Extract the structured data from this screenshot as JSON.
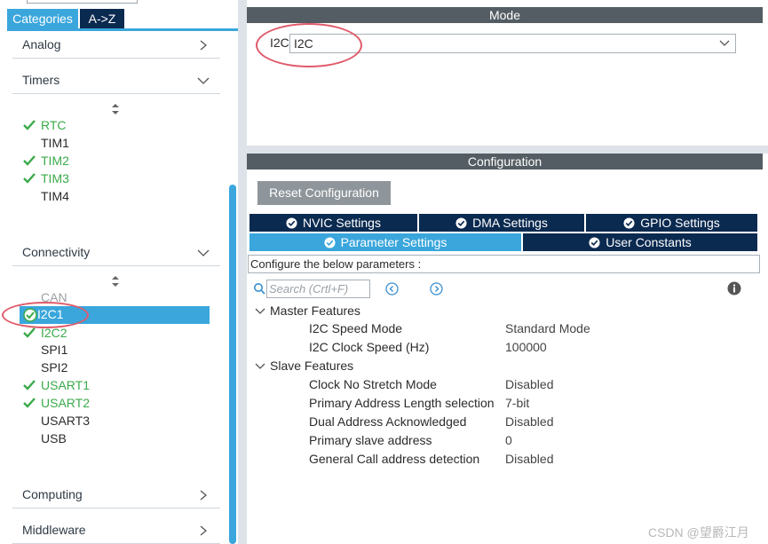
{
  "left_panel": {
    "tabs": [
      {
        "label": "Categories",
        "active": true
      },
      {
        "label": "A->Z",
        "active": false
      }
    ],
    "categories": {
      "analog": "Analog",
      "timers": "Timers",
      "connectivity": "Connectivity",
      "computing": "Computing",
      "middleware": "Middleware"
    },
    "timers": [
      {
        "name": "RTC",
        "enabled": true
      },
      {
        "name": "TIM1",
        "enabled": false
      },
      {
        "name": "TIM2",
        "enabled": true
      },
      {
        "name": "TIM3",
        "enabled": true
      },
      {
        "name": "TIM4",
        "enabled": false
      }
    ],
    "connectivity": [
      {
        "name": "CAN",
        "enabled": false
      },
      {
        "name": "I2C1",
        "enabled": true,
        "selected": true
      },
      {
        "name": "I2C2",
        "enabled": true
      },
      {
        "name": "SPI1",
        "enabled": false
      },
      {
        "name": "SPI2",
        "enabled": false
      },
      {
        "name": "USART1",
        "enabled": true
      },
      {
        "name": "USART2",
        "enabled": true
      },
      {
        "name": "USART3",
        "enabled": false
      },
      {
        "name": "USB",
        "enabled": false
      }
    ]
  },
  "mode": {
    "title": "Mode",
    "field_label": "I2C",
    "field_value": "I2C"
  },
  "configuration": {
    "title": "Configuration",
    "reset_button": "Reset Configuration",
    "tabs_row1": [
      "NVIC Settings",
      "DMA Settings",
      "GPIO Settings"
    ],
    "tabs_row2": [
      "Parameter Settings",
      "User Constants"
    ],
    "active_tab": "Parameter Settings",
    "description": "Configure the below parameters :",
    "search_placeholder": "Search (Crtl+F)",
    "groups": [
      {
        "name": "Master Features",
        "params": [
          {
            "name": "I2C Speed Mode",
            "value": "Standard Mode"
          },
          {
            "name": "I2C Clock Speed (Hz)",
            "value": "100000"
          }
        ]
      },
      {
        "name": "Slave Features",
        "params": [
          {
            "name": "Clock No Stretch Mode",
            "value": "Disabled"
          },
          {
            "name": "Primary Address Length selection",
            "value": "7-bit"
          },
          {
            "name": "Dual Address Acknowledged",
            "value": "Disabled"
          },
          {
            "name": "Primary slave address",
            "value": "0"
          },
          {
            "name": "General Call address detection",
            "value": "Disabled"
          }
        ]
      }
    ]
  },
  "watermark": "CSDN @望爵江月",
  "colors": {
    "accent": "#3aa6dc",
    "dark_navy": "#0b2a50",
    "header_gray": "#545d63",
    "enabled_green": "#3aaa4a",
    "annotation_red": "#e05a6a"
  }
}
